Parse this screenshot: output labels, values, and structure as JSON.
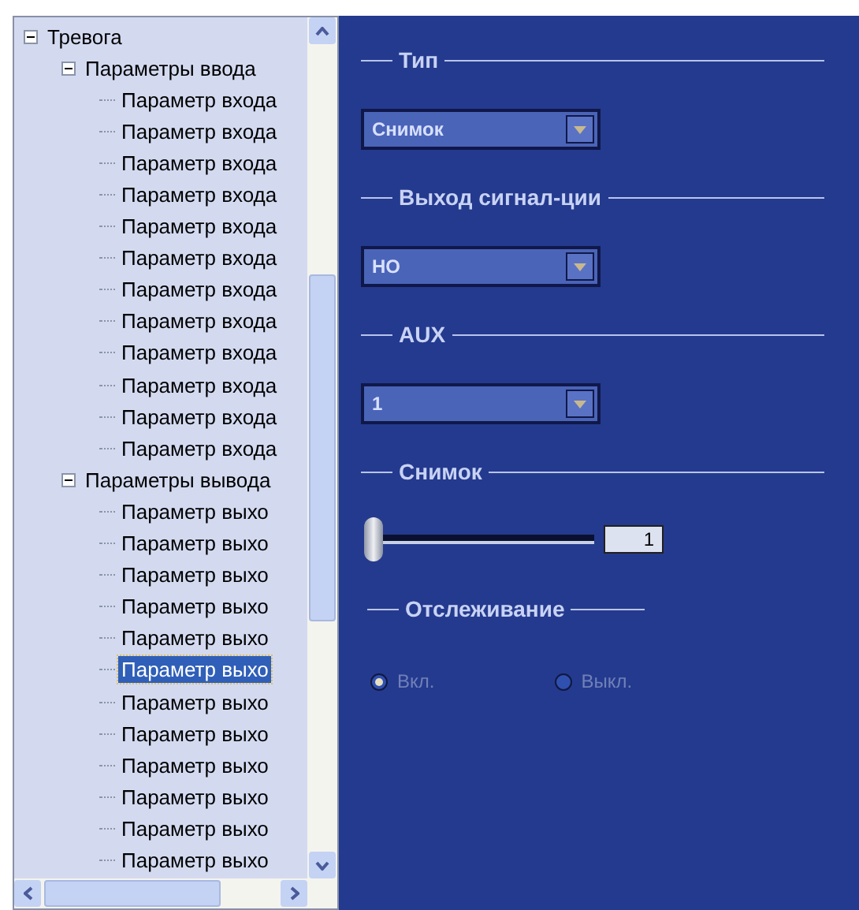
{
  "tree": {
    "items": [
      {
        "label": "Тревога",
        "expanded": true,
        "selected": false,
        "children": [
          {
            "label": "Параметры ввода",
            "expanded": true,
            "selected": false,
            "children": [
              {
                "label": "Параметр входа",
                "selected": false
              },
              {
                "label": "Параметр входа",
                "selected": false
              },
              {
                "label": "Параметр входа",
                "selected": false
              },
              {
                "label": "Параметр входа",
                "selected": false
              },
              {
                "label": "Параметр входа",
                "selected": false
              },
              {
                "label": "Параметр входа",
                "selected": false
              },
              {
                "label": "Параметр входа",
                "selected": false
              },
              {
                "label": "Параметр входа",
                "selected": false
              },
              {
                "label": "Параметр входа",
                "selected": false
              },
              {
                "label": "Параметр входа",
                "selected": false
              },
              {
                "label": "Параметр входа",
                "selected": false
              },
              {
                "label": "Параметр входа",
                "selected": false
              }
            ]
          },
          {
            "label": "Параметры вывода",
            "expanded": true,
            "selected": false,
            "children": [
              {
                "label": "Параметр выхо",
                "selected": false
              },
              {
                "label": "Параметр выхо",
                "selected": false
              },
              {
                "label": "Параметр выхо",
                "selected": false
              },
              {
                "label": "Параметр выхо",
                "selected": false
              },
              {
                "label": "Параметр выхо",
                "selected": false
              },
              {
                "label": "Параметр выхо",
                "selected": true
              },
              {
                "label": "Параметр выхо",
                "selected": false
              },
              {
                "label": "Параметр выхо",
                "selected": false
              },
              {
                "label": "Параметр выхо",
                "selected": false
              },
              {
                "label": "Параметр выхо",
                "selected": false
              },
              {
                "label": "Параметр выхо",
                "selected": false
              },
              {
                "label": "Параметр выхо",
                "selected": false
              }
            ]
          }
        ]
      }
    ]
  },
  "sections": [
    {
      "kind": "dropdown",
      "title": "Тип",
      "value": "Снимок"
    },
    {
      "kind": "dropdown",
      "title": "Выход сигнал-ции",
      "value": "НО"
    },
    {
      "kind": "dropdown",
      "title": "AUX",
      "value": "1"
    },
    {
      "kind": "slider",
      "title": "Снимок",
      "level": 0,
      "value": "1"
    },
    {
      "kind": "radio",
      "title": "Отслеживание",
      "disabled": true,
      "options": [
        {
          "label": "Вкл.",
          "selected": true
        },
        {
          "label": "Выкл.",
          "selected": false
        }
      ]
    }
  ]
}
